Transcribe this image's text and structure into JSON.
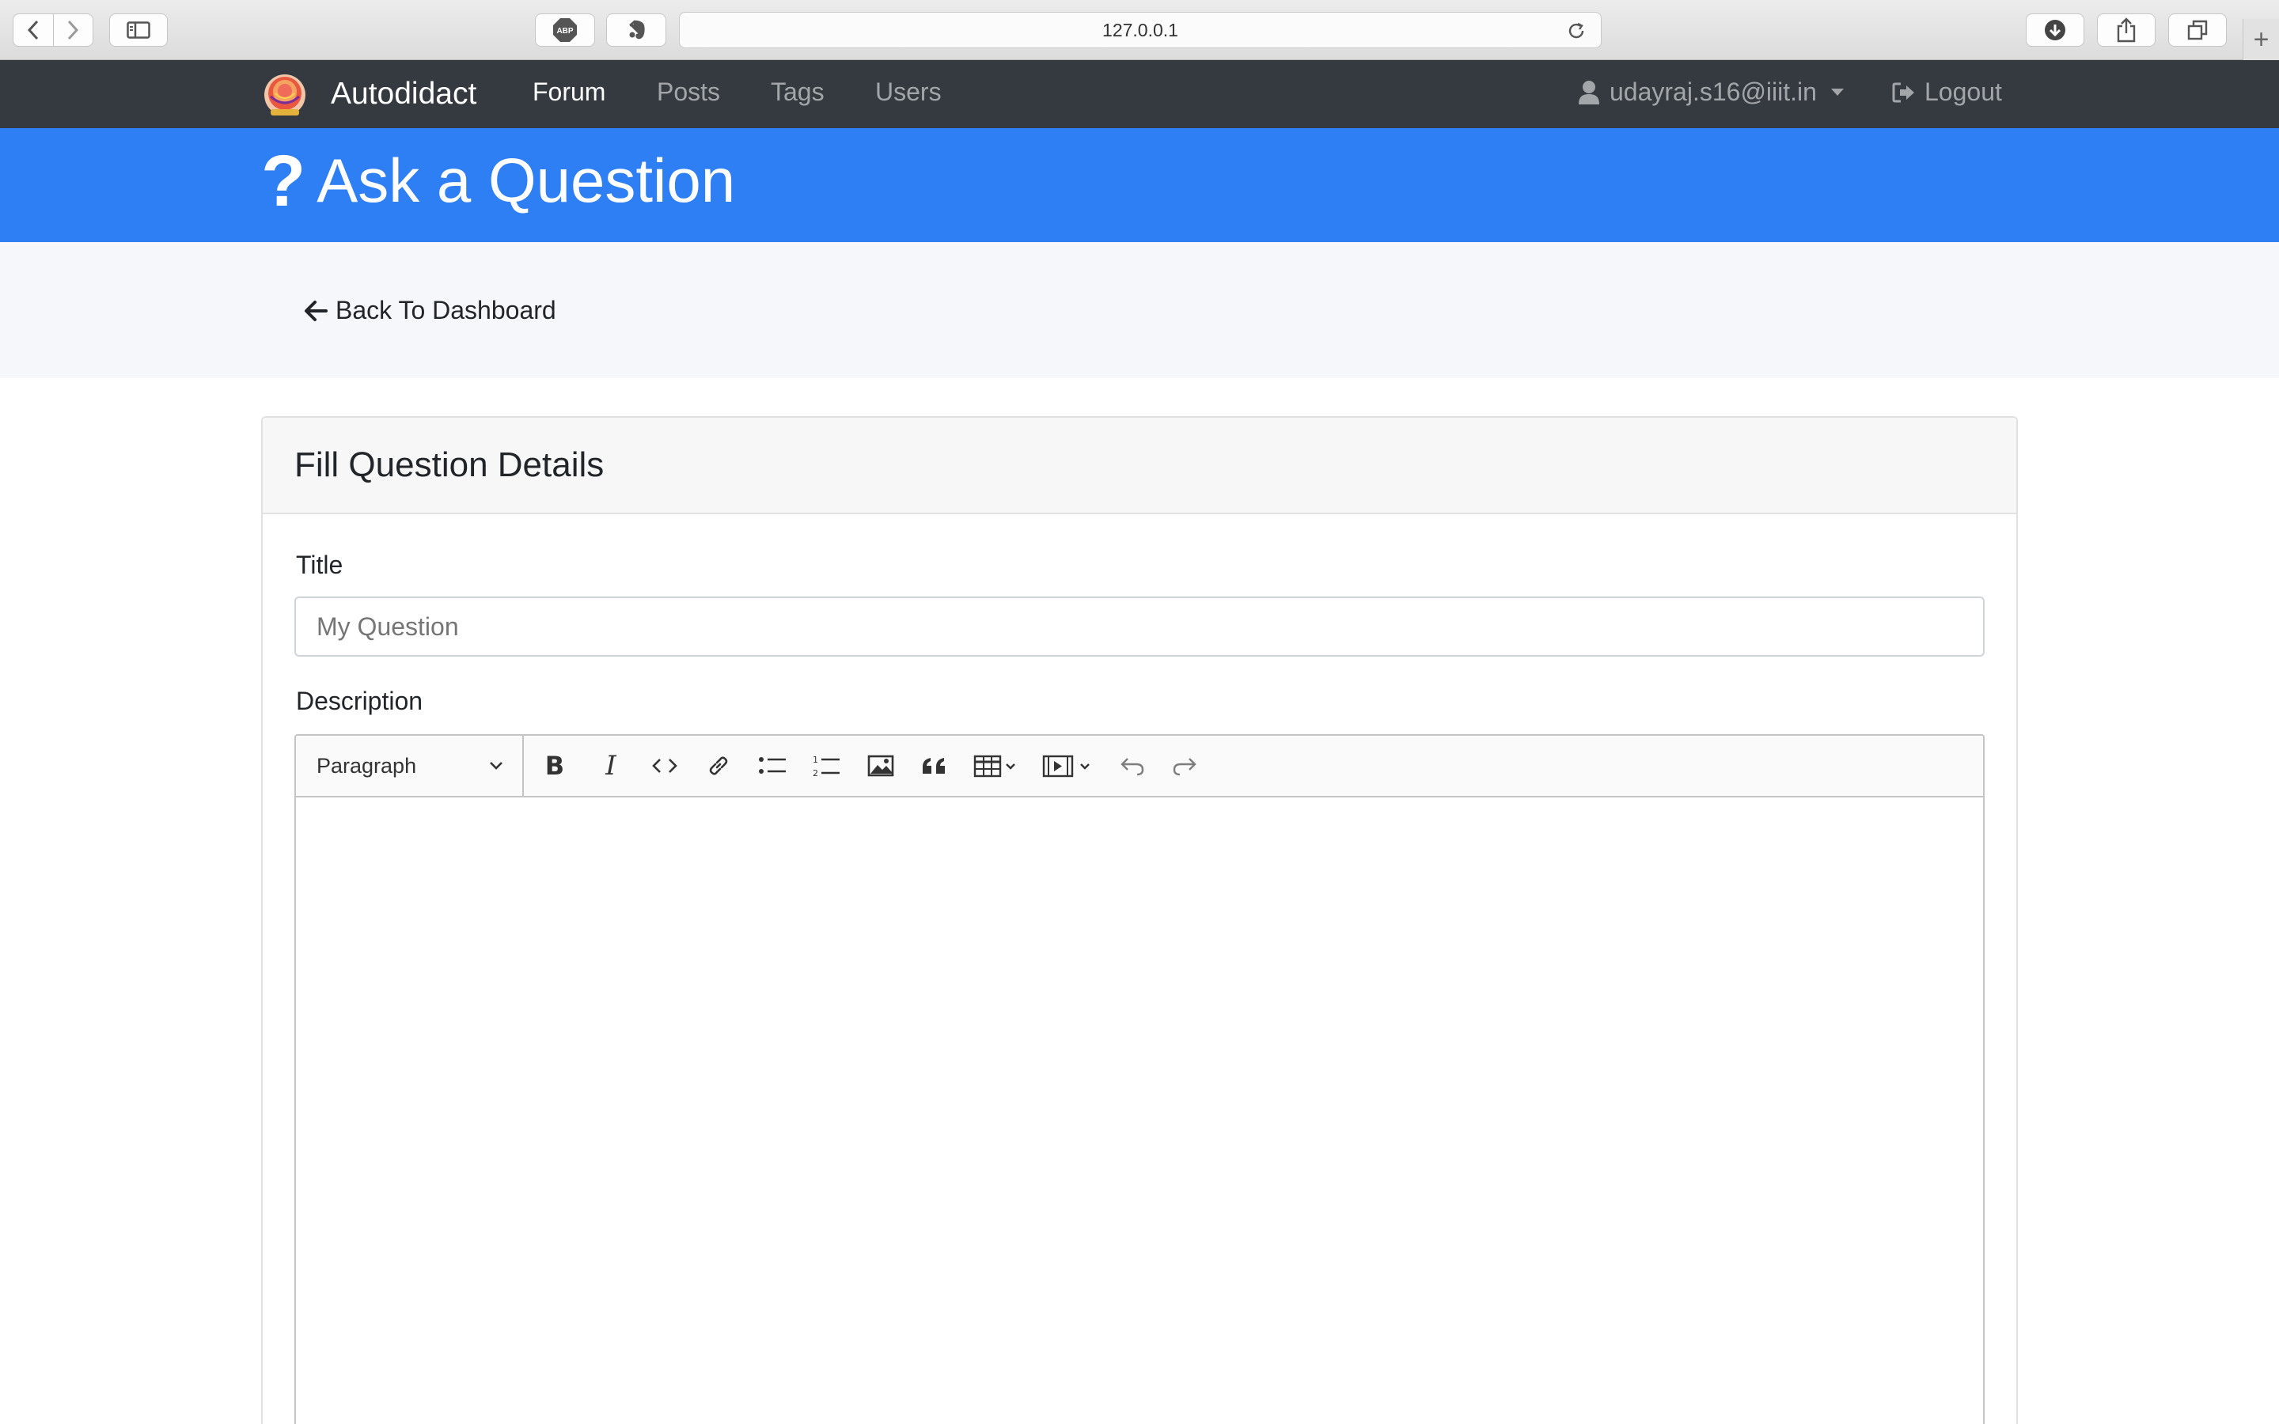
{
  "browser": {
    "url": "127.0.0.1",
    "adblock_label": "ABP"
  },
  "navbar": {
    "brand": "Autodidact",
    "links": [
      "Forum",
      "Posts",
      "Tags",
      "Users"
    ],
    "active_link": "Forum",
    "user_email": "udayraj.s16@iiit.in",
    "logout_label": "Logout"
  },
  "header": {
    "icon": "question-icon",
    "title": "Ask a Question"
  },
  "breadcrumb": {
    "back_label": "Back To Dashboard"
  },
  "form": {
    "card_title": "Fill Question Details",
    "title_label": "Title",
    "title_placeholder": "My Question",
    "title_value": "",
    "description_label": "Description",
    "editor": {
      "block_format": "Paragraph",
      "toolbar_icons": [
        "bold-icon",
        "italic-icon",
        "code-icon",
        "link-icon",
        "bulleted-list-icon",
        "numbered-list-icon",
        "image-icon",
        "blockquote-icon",
        "table-icon",
        "media-embed-icon",
        "undo-icon",
        "redo-icon"
      ],
      "content": ""
    }
  },
  "colors": {
    "navbar_bg": "#343a40",
    "header_bg": "#2f7ff4",
    "subbar_bg": "#f5f7fa"
  }
}
